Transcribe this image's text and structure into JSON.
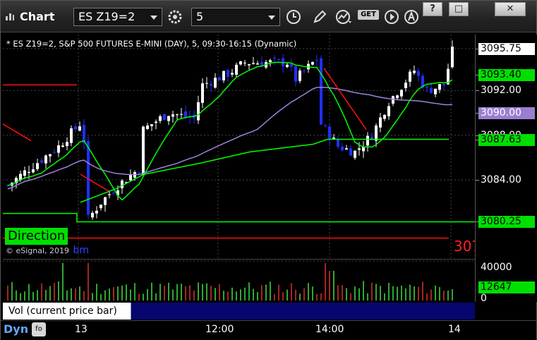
{
  "window": {
    "title": "Chart",
    "symbol": "ES Z19=2",
    "interval": "5",
    "controls": [
      "?",
      "□",
      "✕"
    ]
  },
  "toolbar": {
    "icons": [
      "settings-icon",
      "clock-icon",
      "pencil-icon",
      "indicator-icon",
      "get-icon",
      "play-icon",
      "alert-icon"
    ],
    "get_label": "GET"
  },
  "chart": {
    "header": "* ES Z19=2, S&P 500 FUTURES E-MINI (DAY), 5, 09:30-16:15 (Dynamic)",
    "direction_label": "Direction",
    "copyright": "© eSignal, 2019",
    "cut_text": "bm",
    "right_red_value": "307",
    "price_labels": [
      {
        "text": "3095.75",
        "bg": "#ffffff",
        "fg": "#000000"
      },
      {
        "text": "3093.40",
        "bg": "#00e000",
        "fg": "#000000"
      },
      {
        "text": "3092.00",
        "bg": "",
        "fg": "#ffffff"
      },
      {
        "text": "3090.00",
        "bg": "#9a7fd0",
        "fg": "#ffffff"
      },
      {
        "text": "3088.00",
        "bg": "",
        "fg": "#ffffff"
      },
      {
        "text": "3087.63",
        "bg": "#00e000",
        "fg": "#000000"
      },
      {
        "text": "3084.00",
        "bg": "",
        "fg": "#ffffff"
      },
      {
        "text": "3080.25",
        "bg": "#00e000",
        "fg": "#000000"
      }
    ]
  },
  "volume": {
    "panel_label": "Vol (current price bar)",
    "close_icon": "x",
    "scale_top": "40000",
    "current_value": "12647",
    "scale_zero": "0"
  },
  "xaxis": {
    "labels": [
      "13",
      "12:00",
      "14:00",
      "14"
    ]
  },
  "footer": {
    "dyn_label": "Dyn",
    "dyn_icon": "fo"
  },
  "colors": {
    "up_candle": "#ffffff",
    "down_candle": "#2030ff",
    "green_line": "#00ff00",
    "red_line": "#ff1010",
    "purple_line": "#a080e0",
    "green_fill": "#00e000",
    "vol_up": "#40e040",
    "vol_down": "#e03030"
  },
  "chart_data": {
    "type": "candlestick",
    "title": "ES Z19=2, S&P 500 FUTURES E-MINI (DAY), 5, 09:30-16:15 (Dynamic)",
    "x_labels": [
      "13",
      "12:00",
      "14:00",
      "14"
    ],
    "ylim": [
      3077,
      3097
    ],
    "y_ticks": [
      3084.0,
      3088.0,
      3092.0,
      3095.75
    ],
    "last_price": 3095.75,
    "levels": {
      "green_1": 3093.4,
      "purple": 3090.0,
      "green_2": 3087.63,
      "green_3": 3080.25
    },
    "volume_scale": [
      0,
      40000
    ],
    "volume_current": 12647
  }
}
